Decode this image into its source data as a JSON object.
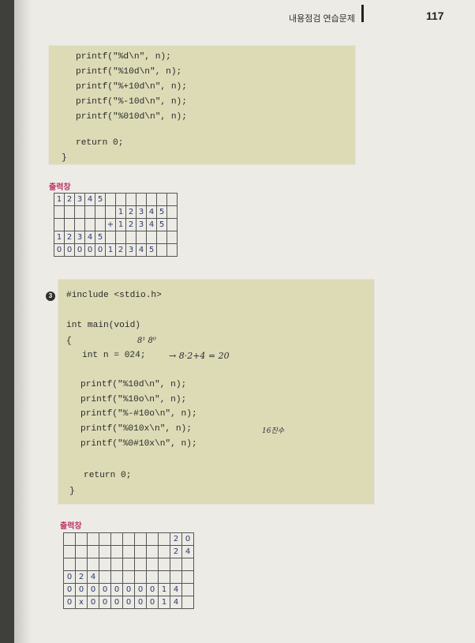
{
  "header": {
    "title": "내용점검 연습문제",
    "page_number": "117"
  },
  "box1": {
    "lines": [
      "printf(\"%d\\n\", n);",
      "printf(\"%10d\\n\", n);",
      "printf(\"%+10d\\n\", n);",
      "printf(\"%-10d\\n\", n);",
      "printf(\"%010d\\n\", n);",
      "return 0;",
      "}"
    ]
  },
  "output1": {
    "label": "출력창",
    "rows": [
      [
        "1",
        "2",
        "3",
        "4",
        "5",
        "",
        "",
        "",
        "",
        "",
        "",
        ""
      ],
      [
        "",
        "",
        "",
        "",
        "",
        "",
        "1",
        "2",
        "3",
        "4",
        "5",
        ""
      ],
      [
        "",
        "",
        "",
        "",
        "",
        "+",
        "1",
        "2",
        "3",
        "4",
        "5",
        ""
      ],
      [
        "1",
        "2",
        "3",
        "4",
        "5",
        "",
        "",
        "",
        "",
        "",
        "",
        ""
      ],
      [
        "0",
        "0",
        "0",
        "0",
        "0",
        "1",
        "2",
        "3",
        "4",
        "5",
        "",
        ""
      ]
    ]
  },
  "problem3": {
    "number": "3",
    "lines": [
      "#include <stdio.h>",
      "int main(void)",
      "{",
      "int n = 024;",
      "printf(\"%10d\\n\", n);",
      "printf(\"%10o\\n\", n);",
      "printf(\"%-#10o\\n\", n);",
      "printf(\"%010x\\n\", n);",
      "printf(\"%0#10x\\n\", n);",
      "return 0;",
      "}"
    ],
    "annotations": {
      "above_number": "8¹ 8⁰",
      "arrow_note": "→ 8·2+4 = 20",
      "side_note": "16진수"
    }
  },
  "output2": {
    "label": "출력창",
    "rows": [
      [
        "",
        "",
        "",
        "",
        "",
        "",
        "",
        "",
        "",
        "2",
        "0"
      ],
      [
        "",
        "",
        "",
        "",
        "",
        "",
        "",
        "",
        "",
        "2",
        "4"
      ],
      [
        "",
        "",
        "",
        "",
        "",
        "",
        "",
        "",
        "",
        "",
        ""
      ],
      [
        "0",
        "2",
        "4",
        "",
        "",
        "",
        "",
        "",
        "",
        "",
        ""
      ],
      [
        "0",
        "0",
        "0",
        "0",
        "0",
        "0",
        "0",
        "0",
        "1",
        "4",
        ""
      ],
      [
        "0",
        "x",
        "0",
        "0",
        "0",
        "0",
        "0",
        "0",
        "1",
        "4",
        ""
      ]
    ]
  }
}
